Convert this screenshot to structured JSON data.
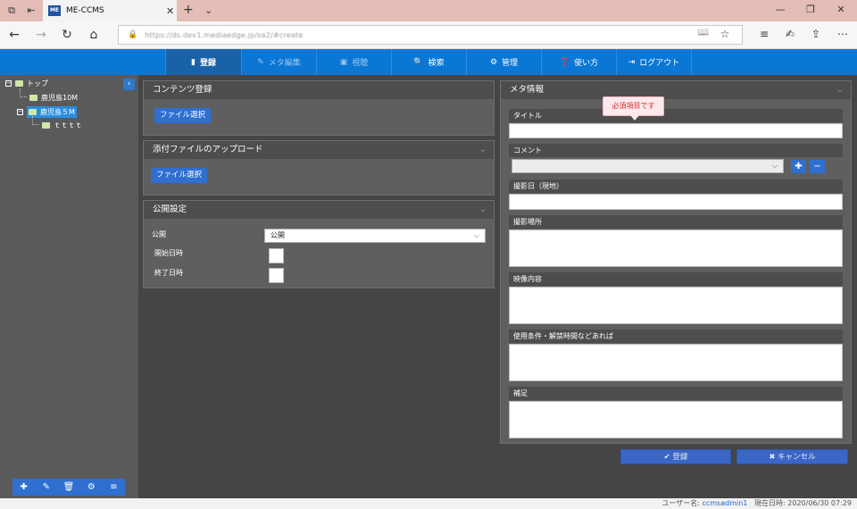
{
  "browser": {
    "tab_title": "ME-CCMS",
    "favicon_text": "ME",
    "url": "https://ds.dev1.mediaedge.jp/sa2/#create"
  },
  "nav": {
    "items": [
      {
        "label": "登録",
        "icon": "edit-icon",
        "glyph": "▮"
      },
      {
        "label": "メタ編集",
        "icon": "pencil-icon",
        "glyph": "✎"
      },
      {
        "label": "視聴",
        "icon": "play-icon",
        "glyph": "▣"
      },
      {
        "label": "検索",
        "icon": "search-icon",
        "glyph": "🔍"
      },
      {
        "label": "管理",
        "icon": "gear-icon",
        "glyph": "⚙"
      },
      {
        "label": "使い方",
        "icon": "help-icon",
        "glyph": "❓"
      },
      {
        "label": "ログアウト",
        "icon": "logout-icon",
        "glyph": "⇥"
      }
    ]
  },
  "tree": {
    "root": "トップ",
    "children": [
      "鹿児島10M",
      "鹿児島５M"
    ],
    "grandchild": "ｔｔｔｔ"
  },
  "content_panel": {
    "title": "コンテンツ登録",
    "button": "ファイル選択"
  },
  "attach_panel": {
    "title": "添付ファイルのアップロード",
    "button": "ファイル選択"
  },
  "publish_panel": {
    "title": "公開設定",
    "publish_label": "公開",
    "publish_value": "公開",
    "start_label": "開始日時",
    "end_label": "終了日時"
  },
  "meta_panel": {
    "title": "メタ情報",
    "tooltip": "必須項目です",
    "fields": {
      "title": "タイトル",
      "comment": "コメント",
      "shoot_date": "撮影日（現地）",
      "location": "撮影場所",
      "content": "映像内容",
      "conditions": "使用条件・解禁時間などあれば",
      "notes": "補足"
    }
  },
  "actions": {
    "register": "✔ 登録",
    "cancel": "✖ キャンセル"
  },
  "status": {
    "user_label": "ユーザー名:",
    "user_value": "ccmsadmin1",
    "time_label": "現在日時:",
    "time_value": "2020/06/30 07:29"
  }
}
